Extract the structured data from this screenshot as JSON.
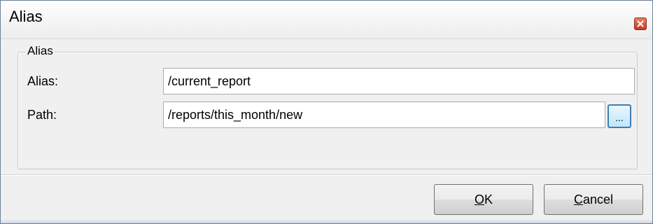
{
  "window": {
    "title": "Alias",
    "close_icon": "close-icon",
    "accent_color": "#c23a22"
  },
  "group": {
    "legend": "Alias"
  },
  "fields": {
    "alias_label": "Alias:",
    "alias_value": "/current_report",
    "path_label": "Path:",
    "path_value": "/reports/this_month/new"
  },
  "browse": {
    "label": "..."
  },
  "buttons": {
    "ok_mnemonic": "O",
    "ok_rest": "K",
    "cancel_mnemonic": "C",
    "cancel_rest": "ancel"
  }
}
